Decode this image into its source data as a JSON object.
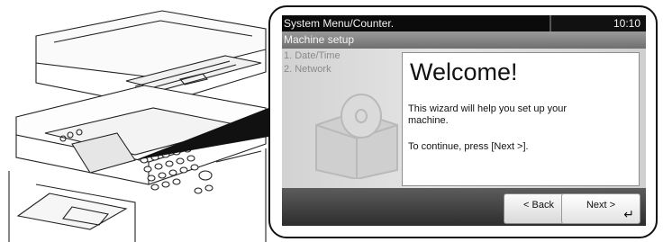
{
  "screen": {
    "title": "System Menu/Counter.",
    "time": "10:10",
    "subheader": "Machine setup",
    "steps": [
      "1. Date/Time",
      "2. Network"
    ]
  },
  "dialog": {
    "heading": "Welcome!",
    "paragraph1": "This wizard will help you set up your machine.",
    "paragraph2": "To continue, press [Next >]."
  },
  "buttons": {
    "back": "< Back",
    "next": "Next >"
  },
  "icons": {
    "enter": "enter-return-icon",
    "enter_glyph": "↵"
  }
}
